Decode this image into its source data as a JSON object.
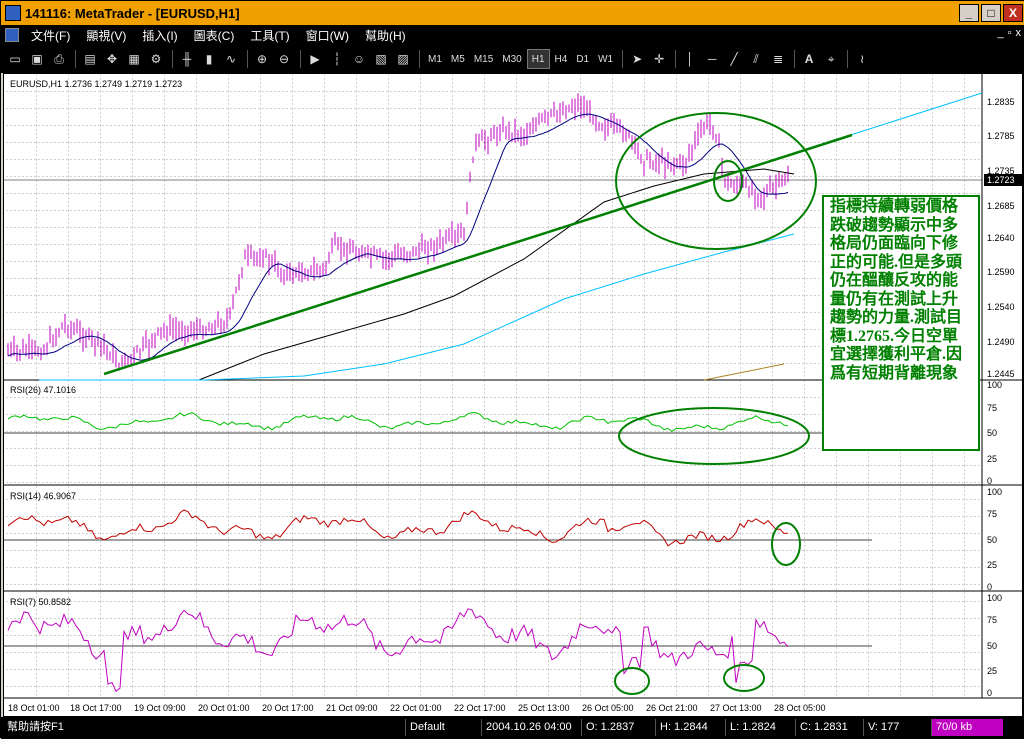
{
  "window": {
    "title": "141116: MetaTrader - [EURUSD,H1]",
    "controls": [
      "_",
      "□",
      "X"
    ]
  },
  "menu": {
    "items": [
      "文件(F)",
      "顯視(V)",
      "插入(I)",
      "圖表(C)",
      "工具(T)",
      "窗口(W)",
      "幫助(H)"
    ],
    "mdi_controls": [
      "_",
      "▫",
      "x"
    ]
  },
  "toolbar": {
    "timeframes": [
      "M1",
      "M5",
      "M15",
      "M30",
      "H1",
      "H4",
      "D1",
      "W1"
    ],
    "active_timeframe": "H1",
    "icons": [
      "new-chart-icon",
      "save-icon",
      "print-icon",
      "market-watch-icon",
      "navigator-icon",
      "terminal-icon",
      "tester-icon",
      "bar-chart-icon",
      "candle-chart-icon",
      "line-chart-icon",
      "zoom-in-icon",
      "zoom-out-icon",
      "autoscroll-icon",
      "chart-shift-icon",
      "expert-icon",
      "template-icon",
      "period-icon",
      "cursor-icon",
      "crosshair-icon",
      "vertical-line-icon",
      "horizontal-line-icon",
      "trendline-icon",
      "channel-icon",
      "fibonacci-icon",
      "text-icon",
      "label-icon",
      "fibo-fan-icon"
    ]
  },
  "main_chart": {
    "header": "EURUSD,H1  1.2736 1.2749 1.2719 1.2723",
    "price_labels": [
      "1.2835",
      "1.2785",
      "1.2735",
      "1.2685",
      "1.2640",
      "1.2590",
      "1.2540",
      "1.2490",
      "1.2445"
    ],
    "current_price": "1.2723",
    "annotation": "指標持續轉弱價格跌破趨勢顯示中多格局仍面臨向下修正的可能.但是多頭仍在醞釀反攻的能量仍有在測試上升趨勢的力量.測試目標1.2765.今日空單宜選擇獲利平倉.因爲有短期背離現象"
  },
  "rsi26": {
    "header": "RSI(26)  47.1016",
    "levels": [
      "100",
      "75",
      "50",
      "25",
      "0"
    ]
  },
  "rsi14": {
    "header": "RSI(14)  46.9067",
    "levels": [
      "100",
      "75",
      "50",
      "25",
      "0"
    ]
  },
  "rsi7": {
    "header": "RSI(7)  50.8582",
    "levels": [
      "100",
      "75",
      "50",
      "25",
      "0"
    ]
  },
  "time_axis": [
    "18 Oct 01:00",
    "18 Oct 17:00",
    "19 Oct 09:00",
    "20 Oct 01:00",
    "20 Oct 17:00",
    "21 Oct 09:00",
    "22 Oct 01:00",
    "22 Oct 17:00",
    "25 Oct 13:00",
    "26 Oct 05:00",
    "26 Oct 21:00",
    "27 Oct 13:00",
    "28 Oct 05:00"
  ],
  "status": {
    "help": "幫助請按F1",
    "profile": "Default",
    "datetime": "2004.10.26 04:00",
    "open": "O: 1.2837",
    "high": "H: 1.2844",
    "low": "L: 1.2824",
    "close": "C: 1.2831",
    "volume": "V: 177",
    "traffic": "70/0 kb"
  },
  "colors": {
    "title_bar": "#f0a000",
    "price_bars": "#c000c0",
    "trendline": "#008000",
    "rsi26": "#00c000",
    "rsi14": "#c00000",
    "rsi7": "#c000c0",
    "ma_fast": "#000080",
    "ma_slow": "#000000",
    "ma_long": "#00c0ff"
  }
}
